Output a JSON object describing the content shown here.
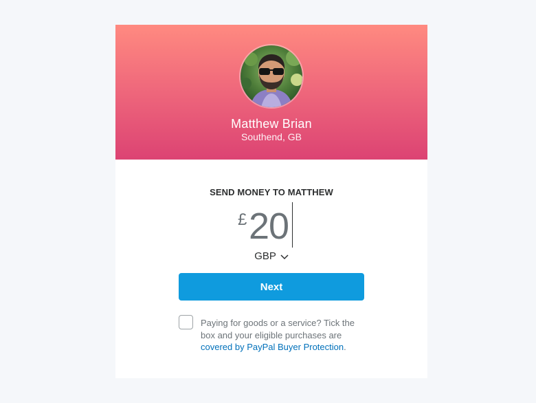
{
  "recipient": {
    "name": "Matthew Brian",
    "location": "Southend, GB"
  },
  "send": {
    "heading": "SEND MONEY TO MATTHEW",
    "currency_symbol": "£",
    "amount": "20",
    "currency_code": "GBP"
  },
  "actions": {
    "next_label": "Next"
  },
  "protection": {
    "text_before": "Paying for goods or a service? Tick the box and your eligible purchases are ",
    "link_text": "covered by PayPal Buyer Protection",
    "text_after": "."
  },
  "colors": {
    "header_gradient_top": "#ff8a80",
    "header_gradient_bottom": "#dc4373",
    "primary_button": "#0f9bde",
    "link": "#0070ba"
  },
  "icons": {
    "currency_dropdown": "chevron-down-icon",
    "avatar": "profile-photo"
  }
}
